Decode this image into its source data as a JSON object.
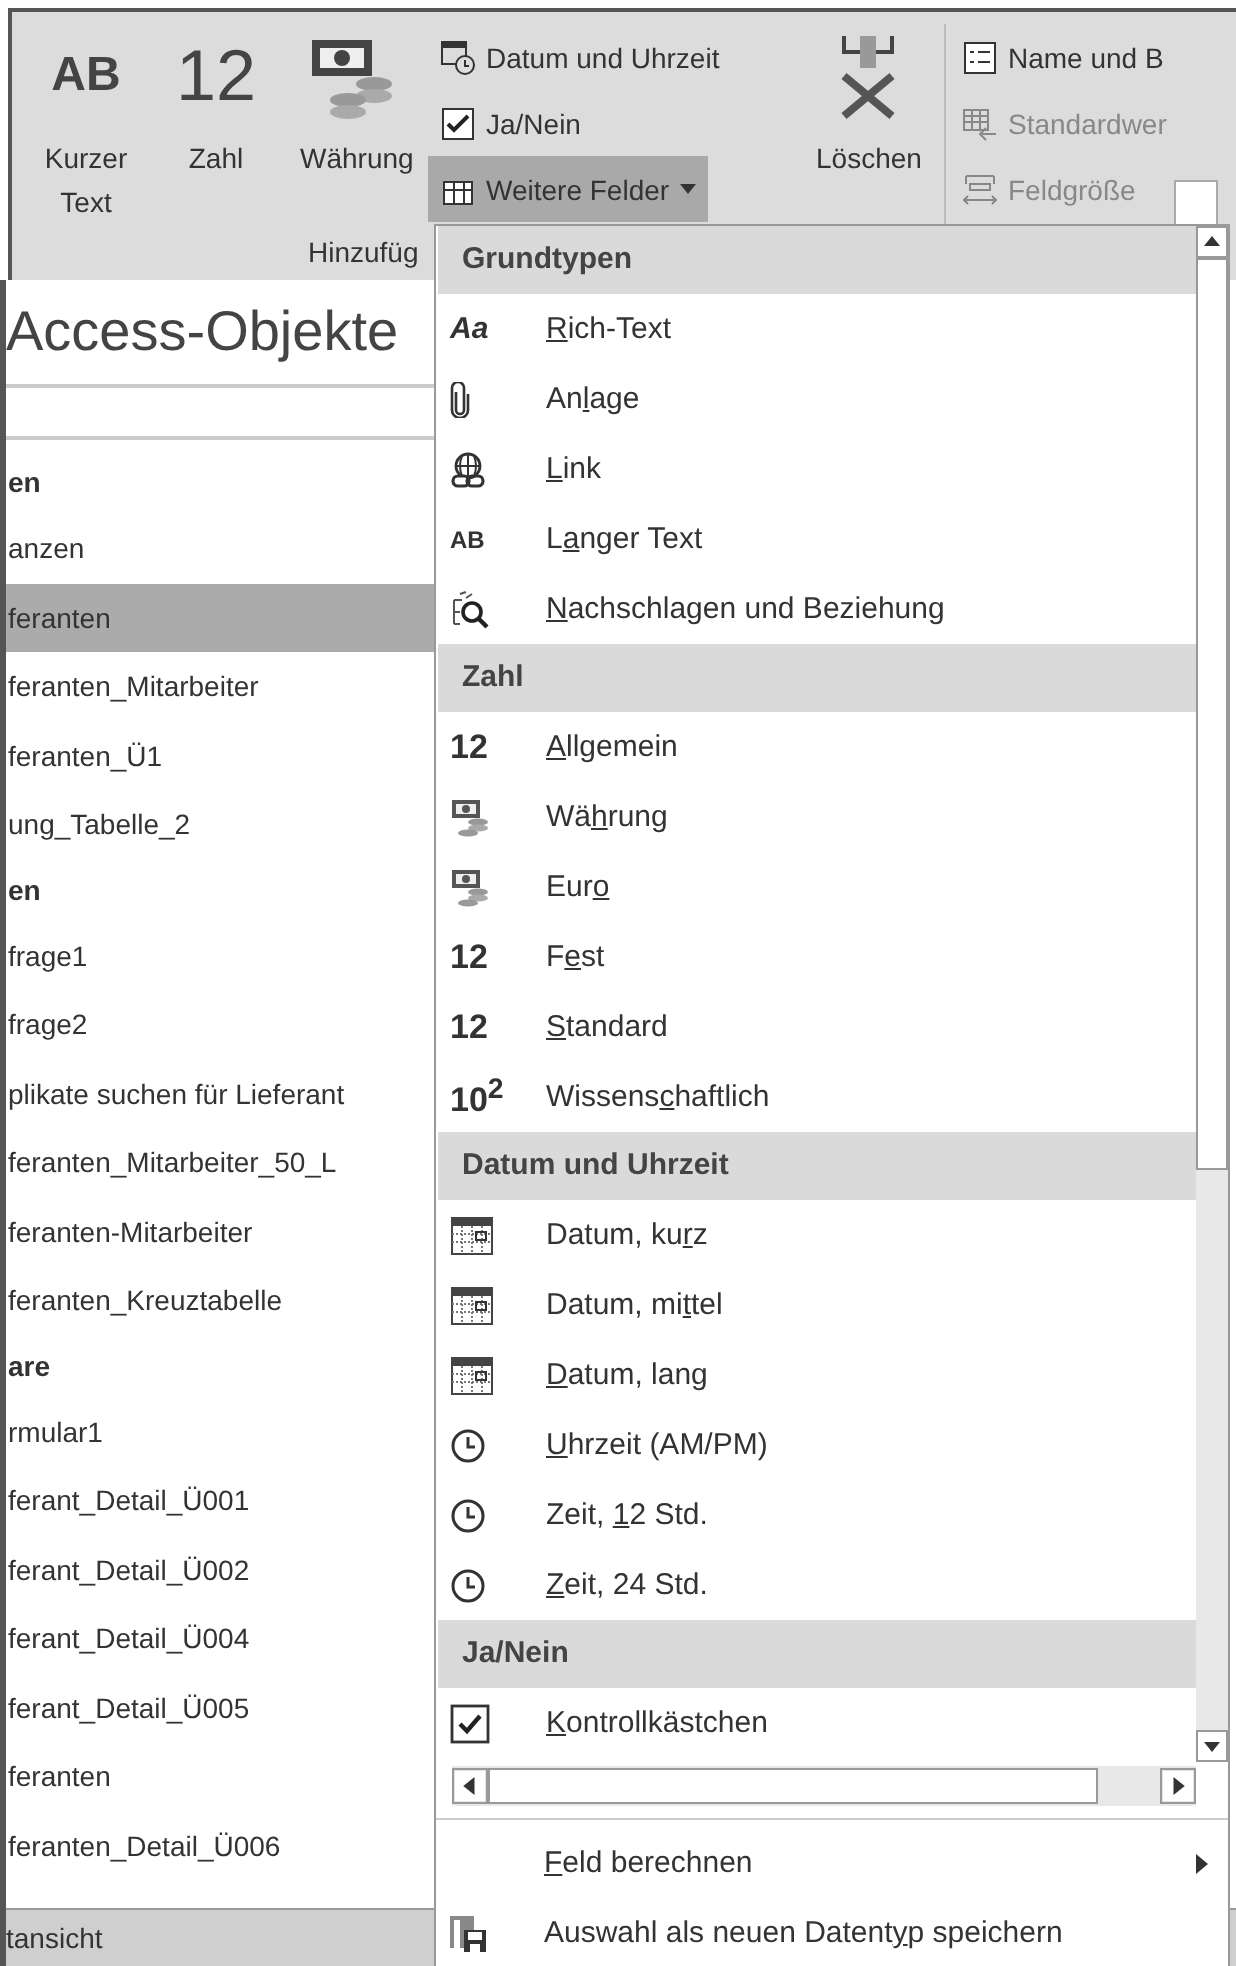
{
  "ribbon": {
    "big_buttons": [
      {
        "kind": "text",
        "icon_text": "AB",
        "label": "Kurzer Text"
      },
      {
        "kind": "text",
        "icon_text": "12",
        "label": "Zahl"
      },
      {
        "kind": "money",
        "label": "Währung"
      }
    ],
    "small_buttons": [
      {
        "kind": "date",
        "label": "Datum und Uhrzeit",
        "selected": false
      },
      {
        "kind": "checkbox",
        "label": "Ja/Nein",
        "selected": false
      },
      {
        "kind": "more",
        "label": "Weitere Felder",
        "selected": true
      }
    ],
    "delete_button": {
      "label": "Löschen"
    },
    "property_buttons": [
      {
        "kind": "name",
        "label": "Name und B",
        "disabled": false
      },
      {
        "kind": "default",
        "label": "Standardwer",
        "disabled": true
      },
      {
        "kind": "size",
        "label": "Feldgröße",
        "disabled": true
      }
    ],
    "group_label": "Hinzufüg"
  },
  "navigation": {
    "title": "Access-Objekte",
    "items": [
      {
        "kind": "header",
        "label": "en",
        "selected": false
      },
      {
        "kind": "item",
        "label": "anzen",
        "selected": false
      },
      {
        "kind": "item",
        "label": "feranten",
        "selected": true
      },
      {
        "kind": "item",
        "label": "feranten_Mitarbeiter",
        "selected": false
      },
      {
        "kind": "item",
        "label": "feranten_Ü1",
        "selected": false
      },
      {
        "kind": "item",
        "label": "ung_Tabelle_2",
        "selected": false
      },
      {
        "kind": "header",
        "label": "en",
        "selected": false
      },
      {
        "kind": "item",
        "label": "frage1",
        "selected": false
      },
      {
        "kind": "item",
        "label": "frage2",
        "selected": false
      },
      {
        "kind": "item",
        "label": "plikate suchen für Lieferant",
        "selected": false
      },
      {
        "kind": "item",
        "label": "feranten_Mitarbeiter_50_L",
        "selected": false
      },
      {
        "kind": "item",
        "label": "feranten-Mitarbeiter",
        "selected": false
      },
      {
        "kind": "item",
        "label": "feranten_Kreuztabelle",
        "selected": false
      },
      {
        "kind": "header",
        "label": "are",
        "selected": false
      },
      {
        "kind": "item",
        "label": "rmular1",
        "selected": false
      },
      {
        "kind": "item",
        "label": "ferant_Detail_Ü001",
        "selected": false
      },
      {
        "kind": "item",
        "label": "ferant_Detail_Ü002",
        "selected": false
      },
      {
        "kind": "item",
        "label": "ferant_Detail_Ü004",
        "selected": false
      },
      {
        "kind": "item",
        "label": "ferant_Detail_Ü005",
        "selected": false
      },
      {
        "kind": "item",
        "label": "feranten",
        "selected": false
      },
      {
        "kind": "item",
        "label": "feranten_Detail_Ü006",
        "selected": false
      }
    ],
    "status": "tansicht"
  },
  "menu": {
    "sections": [
      {
        "header": "Grundtypen",
        "items": [
          {
            "kind": "text-italic",
            "icon_text": "Aa",
            "key": "R",
            "post": "ich-Text"
          },
          {
            "kind": "paperclip",
            "pre": "An",
            "key": "l",
            "post": "age"
          },
          {
            "kind": "globe-link",
            "key": "L",
            "post": "ink"
          },
          {
            "kind": "text-small",
            "icon_text": "AB",
            "pre": "L",
            "key": "a",
            "post": "nger Text"
          },
          {
            "kind": "lookup",
            "key": "N",
            "post": "achschlagen und Beziehung"
          }
        ]
      },
      {
        "header": "Zahl",
        "items": [
          {
            "kind": "text",
            "icon_text": "12",
            "key": "A",
            "post": "llgemein"
          },
          {
            "kind": "money",
            "pre": "Wä",
            "key": "h",
            "post": "rung"
          },
          {
            "kind": "money",
            "pre": "Eur",
            "key": "o"
          },
          {
            "kind": "text",
            "icon_text": "12",
            "pre": "F",
            "key": "e",
            "post": "st"
          },
          {
            "kind": "text",
            "icon_text": "12",
            "key": "S",
            "post": "tandard"
          },
          {
            "kind": "rich",
            "icon_text": "10$^{2}$",
            "pre": "Wissens",
            "key": "c",
            "post": "haftlich"
          }
        ]
      },
      {
        "header": "Datum und Uhrzeit",
        "items": [
          {
            "kind": "calendar",
            "pre": "Datum, ku",
            "key": "r",
            "post": "z"
          },
          {
            "kind": "calendar",
            "pre": "Datum, mi",
            "key": "t",
            "post": "tel"
          },
          {
            "kind": "calendar",
            "key": "D",
            "post": "atum, lang"
          },
          {
            "kind": "clock",
            "key": "U",
            "post": "hrzeit (AM/PM)"
          },
          {
            "kind": "clock",
            "pre": "Zeit, ",
            "key": "1",
            "post": "2 Std."
          },
          {
            "kind": "clock",
            "key": "Z",
            "post": "eit, 24 Std."
          }
        ]
      },
      {
        "header": "Ja/Nein",
        "items": [
          {
            "kind": "checkbox",
            "key": "K",
            "post": "ontrollkästchen"
          }
        ]
      }
    ],
    "footer": [
      {
        "kind": "submenu",
        "key": "F",
        "post": "eld berechnen"
      },
      {
        "kind": "save",
        "pre": "Auswahl als neuen Datent",
        "key": "y",
        "post": "p speichern"
      }
    ]
  }
}
